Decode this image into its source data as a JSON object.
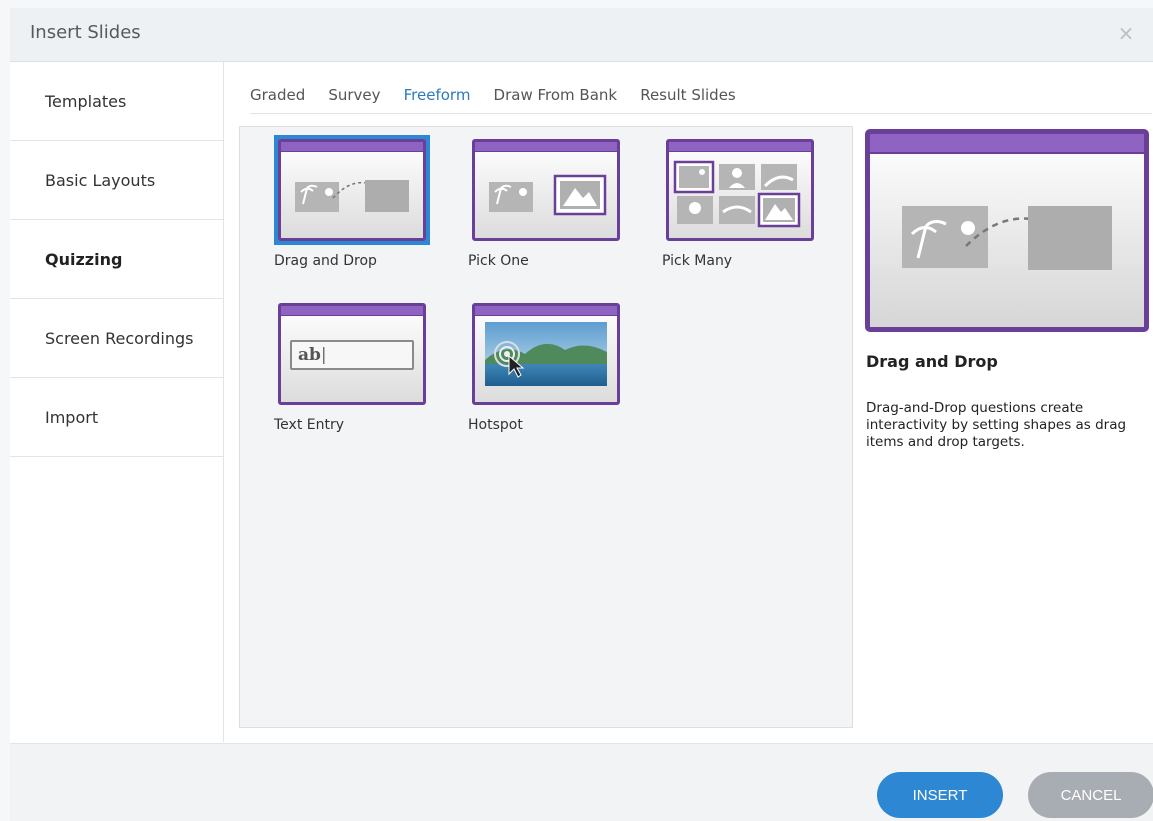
{
  "dialog": {
    "title": "Insert Slides",
    "close_icon": "close-icon",
    "close_glyph": "×"
  },
  "sidebar": {
    "items": [
      {
        "label": "Templates"
      },
      {
        "label": "Basic Layouts"
      },
      {
        "label": "Quizzing",
        "active": true
      },
      {
        "label": "Screen Recordings"
      },
      {
        "label": "Import"
      }
    ]
  },
  "tabs": [
    {
      "label": "Graded"
    },
    {
      "label": "Survey"
    },
    {
      "label": "Freeform",
      "active": true
    },
    {
      "label": "Draw From Bank"
    },
    {
      "label": "Result Slides"
    }
  ],
  "cards": [
    {
      "label": "Drag and Drop",
      "icon": "drag-and-drop-icon",
      "selected": true
    },
    {
      "label": "Pick One",
      "icon": "pick-one-icon"
    },
    {
      "label": "Pick Many",
      "icon": "pick-many-icon"
    },
    {
      "label": "Text Entry",
      "icon": "text-entry-icon",
      "sample_text": "ab"
    },
    {
      "label": "Hotspot",
      "icon": "hotspot-icon"
    }
  ],
  "preview": {
    "title": "Drag and Drop",
    "description": "Drag-and-Drop questions create interactivity by setting shapes as drag items and drop targets."
  },
  "footer": {
    "insert_label": "INSERT",
    "cancel_label": "CANCEL"
  },
  "colors": {
    "accent": "#2d87d3",
    "thumb_border": "#6a3f98",
    "thumb_bar": "#8e63c2",
    "cancel": "#a8adb3"
  }
}
